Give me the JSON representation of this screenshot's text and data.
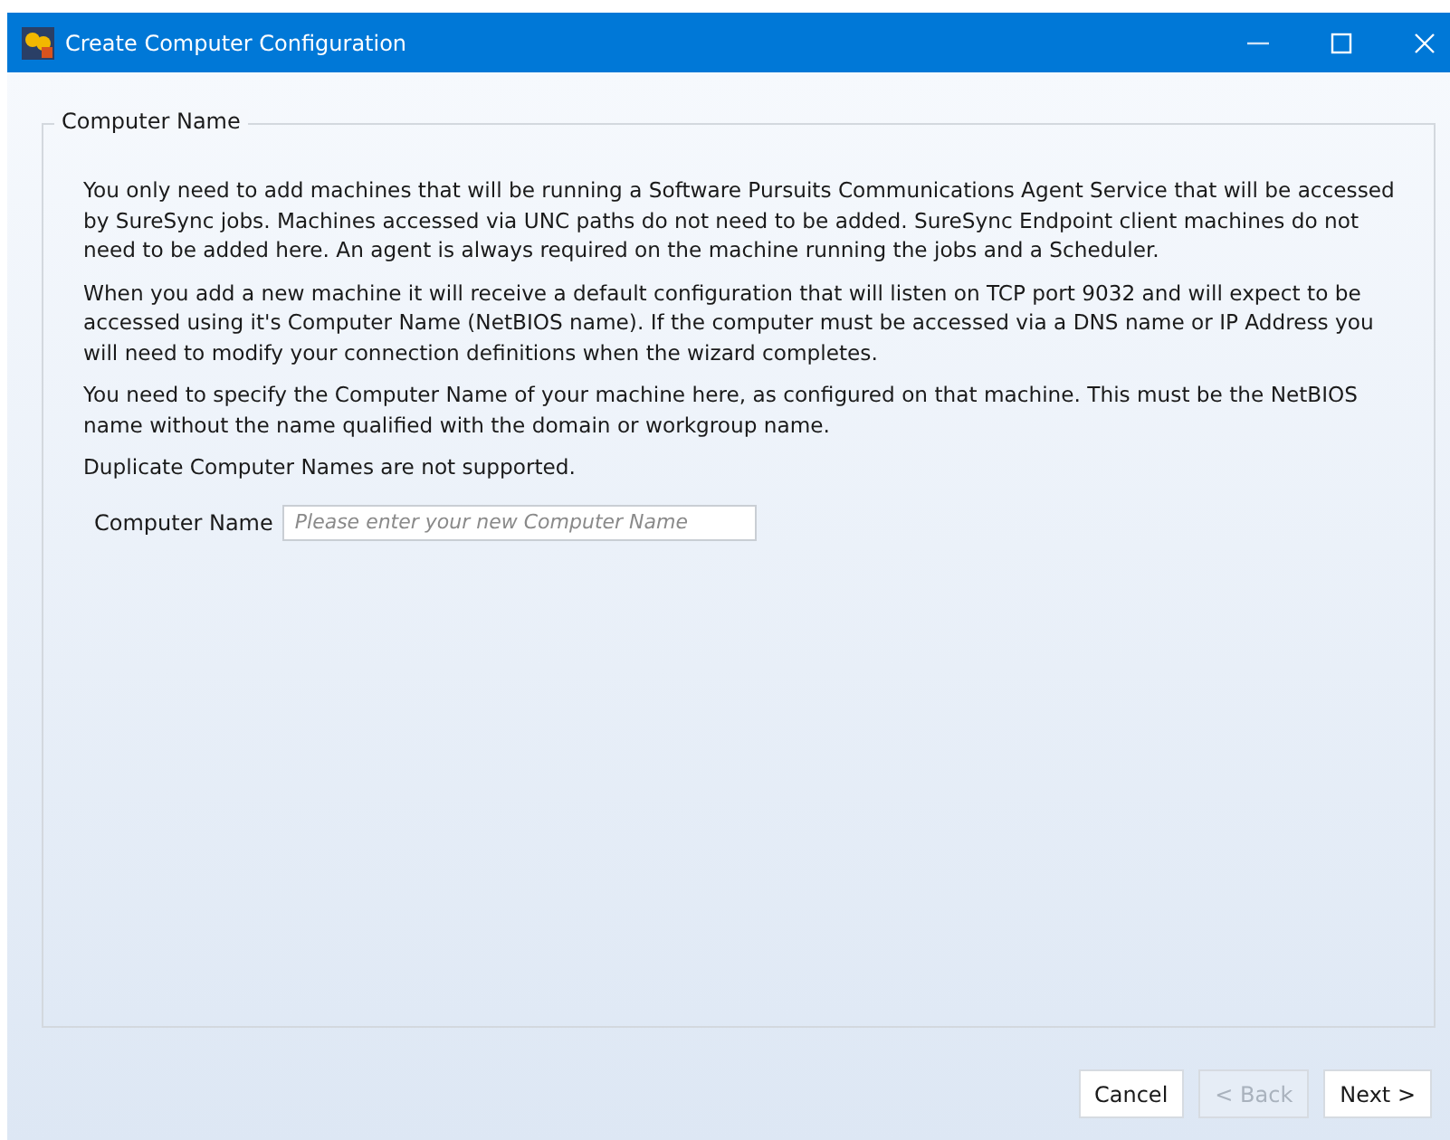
{
  "window": {
    "title": "Create Computer Configuration"
  },
  "group": {
    "title": "Computer Name",
    "paragraphs": [
      "You only need to add machines that will be running a Software Pursuits Communications Agent Service that will be accessed by SureSync jobs. Machines accessed via UNC paths do not need to be added. SureSync Endpoint client machines do not need to be added here. An agent is always required on the machine running the jobs and a Scheduler.",
      "When you add a new machine it will receive a default configuration that will listen on TCP port 9032 and will expect to be accessed using it's Computer Name (NetBIOS name). If the computer must be accessed via a DNS name or IP Address you will need to modify your connection definitions when the wizard completes.",
      "You need to specify the Computer Name of your machine here, as configured on that machine. This must be the NetBIOS name without the name qualified with the domain or workgroup name.",
      "Duplicate Computer Names are not supported."
    ],
    "field": {
      "label": "Computer Name",
      "placeholder": "Please enter your new Computer Name"
    }
  },
  "buttons": [
    {
      "label": "Cancel",
      "disabled": false
    },
    {
      "label": "< Back",
      "disabled": true
    },
    {
      "label": "Next >",
      "disabled": false
    }
  ]
}
